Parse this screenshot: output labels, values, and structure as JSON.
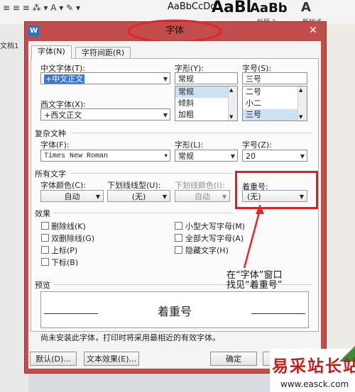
{
  "ribbon": {
    "style_preview_1": "AaBbCcDd",
    "style_preview_2": "AaBl",
    "style_preview_3": "AaBb",
    "style_caption_1": "标题 2",
    "style_caption_2": "新样式",
    "doc_tab": "文档1"
  },
  "dialog": {
    "title": "字体",
    "tabs": [
      "字体(N)",
      "字符间距(R)"
    ],
    "chinese_font_label": "中文字体(T):",
    "chinese_font_value": "+中文正文",
    "western_font_label": "西文字体(X):",
    "western_font_value": "+西文正文",
    "style_label": "字形(Y):",
    "style_value": "常规",
    "style_options": [
      "常规",
      "倾斜",
      "加粗"
    ],
    "size_label": "字号(S):",
    "size_value": "三号",
    "size_options": [
      "二号",
      "小二",
      "三号"
    ],
    "complex_section": "复杂文种",
    "complex_font_label": "字体(F):",
    "complex_font_value": "Times New Roman",
    "complex_style_label": "字形(L):",
    "complex_style_value": "常规",
    "complex_size_label": "字号(Z):",
    "complex_size_value": "20",
    "all_text_section": "所有文字",
    "font_color_label": "字体颜色(C):",
    "font_color_value": "自动",
    "underline_type_label": "下划线线型(U):",
    "underline_type_value": "(无)",
    "underline_color_label": "下划线颜色(I):",
    "underline_color_value": "自动",
    "emphasis_label": "着重号:",
    "emphasis_value": "(无)",
    "effects_section": "效果",
    "effects_left": [
      "删除线(K)",
      "双删除线(G)",
      "上标(P)",
      "下标(B)"
    ],
    "effects_right": [
      "小型大写字母(M)",
      "全部大写字母(A)",
      "隐藏文字(H)"
    ],
    "preview_section": "预览",
    "preview_text": "着重号",
    "note": "尚未安装此字体，打印时将采用最相近的有效字体。",
    "default_button": "默认(D)...",
    "text_effects_button": "文本效果(E)...",
    "ok_button": "确定"
  },
  "annotation": {
    "line1": "在“字体”窗口",
    "line2": "找见“着重号”",
    "color": "#e02828"
  },
  "watermark": {
    "name": "易采站长站",
    "url": "www.easck.com"
  }
}
